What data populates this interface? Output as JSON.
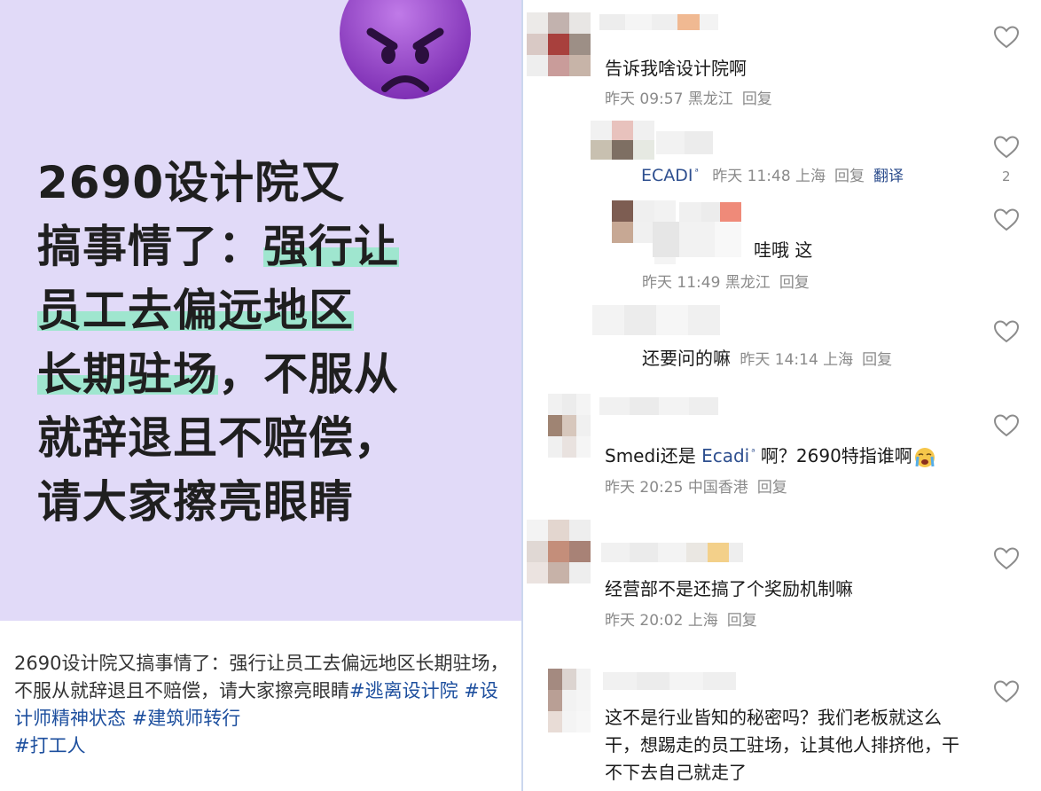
{
  "post": {
    "cover_headline_lines": [
      {
        "pre": "2690设计院又",
        "hl": "",
        "post": ""
      },
      {
        "pre": "搞事情了：",
        "hl": "强行让",
        "post": ""
      },
      {
        "pre": "",
        "hl": "员工去偏远地区",
        "post": ""
      },
      {
        "pre": "",
        "hl": "长期驻场",
        "post": "，不服从"
      },
      {
        "pre": "就辞退且不赔偿，",
        "hl": "",
        "post": ""
      },
      {
        "pre": "请大家擦亮眼睛",
        "hl": "",
        "post": ""
      }
    ],
    "cover_emoji": "angry-purple-face-emoji",
    "caption_text": "2690设计院又搞事情了：强行让员工去偏远地区长期驻场，不服从就辞退且不赔偿，请大家擦亮眼睛",
    "hashtags": [
      "#逃离设计院",
      "#设计师精神状态",
      "#建筑师转行",
      "#打工人"
    ],
    "cover_bg": "#e1daf8",
    "highlight_color": "#9fe6cf",
    "hashtag_color": "#1d4f9e"
  },
  "comments": [
    {
      "text": "告诉我啥设计院啊",
      "time": "昨天 09:57",
      "location": "黑龙江",
      "reply": "回复"
    },
    {
      "mention": "ECADI",
      "time": "昨天 11:48",
      "location": "上海",
      "reply": "回复",
      "translate": "翻译",
      "likes": "2"
    },
    {
      "text": "哇哦 这",
      "time": "昨天 11:49",
      "location": "黑龙江",
      "reply": "回复"
    },
    {
      "text": "还要问的嘛",
      "time": "昨天 14:14",
      "location": "上海",
      "reply": "回复"
    },
    {
      "text_pre": "Smedi还是 ",
      "mention": "Ecadi",
      "text_post": " 啊？2690特指谁啊",
      "emoji": "crying-face-emoji",
      "time": "昨天 20:25",
      "location": "中国香港",
      "reply": "回复"
    },
    {
      "text": "经营部不是还搞了个奖励机制嘛",
      "time": "昨天 20:02",
      "location": "上海",
      "reply": "回复"
    },
    {
      "text": "这不是行业皆知的秘密吗？我们老板就这么干，想踢走的员工驻场，让其他人排挤他，干不下去自己就走了"
    }
  ],
  "icons": {
    "like": "heart-outline-icon",
    "mention_marker": "ᵃ"
  },
  "colors": {
    "mention": "#2e4f8f",
    "meta": "#8a8a8a",
    "divider": "#cbd7ee"
  }
}
